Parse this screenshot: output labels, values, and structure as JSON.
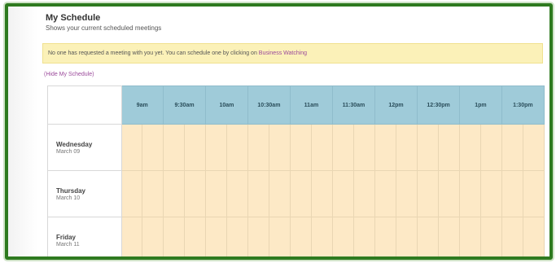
{
  "schedule": {
    "title": "My Schedule",
    "subtitle": "Shows your current scheduled meetings",
    "notice_text": "No one has requested a meeting with you yet. You can schedule one by clicking on",
    "notice_link": "Business Watching",
    "hide_link": "(Hide My Schedule)",
    "times": [
      "9am",
      "9:30am",
      "10am",
      "10:30am",
      "11am",
      "11:30am",
      "12pm",
      "12:30pm",
      "1pm",
      "1:30pm"
    ],
    "days": [
      {
        "name": "Wednesday",
        "date": "March 09"
      },
      {
        "name": "Thursday",
        "date": "March 10"
      },
      {
        "name": "Friday",
        "date": "March 11"
      }
    ]
  },
  "colors": {
    "frame_border": "#2e7a1f",
    "header_bg": "#9fcbd9",
    "slot_bg": "#fde9c6",
    "notice_bg": "#fbf1b8",
    "link": "#9b4a9b"
  }
}
